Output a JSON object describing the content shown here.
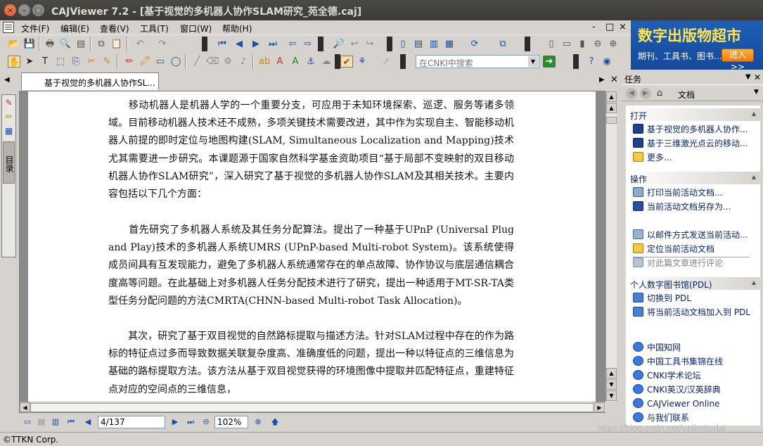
{
  "window": {
    "title": "CAJViewer 7.2 - [基于视觉的多机器人协作SLAM研究_苑全德.caj]",
    "close": "×",
    "minimize": "–",
    "maximize": "□"
  },
  "menu": {
    "items": [
      "文件(F)",
      "编辑(E)",
      "查看(V)",
      "工具(T)",
      "窗口(W)",
      "帮助(H)"
    ],
    "mdi_min": "-",
    "mdi_restore": "□",
    "mdi_close": "×"
  },
  "toolbar": {
    "cnki_search_placeholder": "在CNKI中搜索"
  },
  "ad": {
    "title": "数字出版物超市",
    "subtitle": "期刊、工具书、图书...",
    "button": "进入>>"
  },
  "tabs": {
    "doc_tab": "基于视觉的多机器人协作SL..."
  },
  "sidebar": {
    "catalog_label": "目录"
  },
  "document": {
    "paragraphs": [
      "　　移动机器人是机器人学的一个重要分支，可应用于未知环境探索、巡逻、服务等诸多领域。目前移动机器人技术还不成熟，多项关键技术需要改进，其中作为实现自主、智能移动机器人前提的即时定位与地图构建(SLAM, Simultaneous Localization and Mapping)技术尤其需要进一步研究。本课题源于国家自然科学基金资助项目“基于局部不变映射的双目移动机器人协作SLAM研究”，深入研究了基于视觉的多机器人协作SLAM及其相关技术。主要内容包括以下几个方面：",
      "　　首先研究了多机器人系统及其任务分配算法。提出了一种基于UPnP (Universal Plug and Play)技术的多机器人系统UMRS (UPnP-based Multi-robot System)。该系统使得成员间具有互发现能力，避免了多机器人系统通常存在的单点故障、协作协议与底层通信耦合度高等问题。在此基础上对多机器人任务分配技术进行了研究，提出一种适用于MT-SR-TA类型任务分配问题的方法CMRTA(CHNN-based Multi-robot Task Allocation)。",
      "　　其次，研究了基于双目视觉的自然路标提取与描述方法。针对SLAM过程中存在的作为路标的特征点过多而导致数据关联复杂度高、准确度低的问题，提出一种以特征点的三维信息为基础的路标提取方法。该方法从基于双目视觉获得的环境图像中提取并匹配特征点，重建特征点对应的空间点的三维信息，"
    ]
  },
  "navbar": {
    "page": "4/137",
    "zoom": "102%"
  },
  "taskpane": {
    "header": "任务",
    "doc_label": "文档",
    "sections": {
      "open": {
        "title": "打开",
        "links": [
          "基于视觉的多机器人协作...",
          "基于三维激光点云的移动...",
          "更多..."
        ]
      },
      "actions": {
        "title": "操作",
        "links": [
          "打印当前活动文档...",
          "当前活动文档另存为...",
          "以邮件方式发送当前活动...",
          "定位当前活动文档",
          "对此篇文章进行评论"
        ]
      },
      "pdl": {
        "title": "个人数字图书馆(PDL)",
        "links": [
          "切换到 PDL",
          "将当前活动文档加入到 PDL"
        ]
      },
      "web": {
        "links": [
          "中国知网",
          "中国工具书集锦在线",
          "CNKI学术论坛",
          "CNKI英汉/汉英辞典",
          "CAJViewer Online",
          "与我们联系"
        ]
      }
    }
  },
  "status": {
    "text": "©TTKN Corp."
  },
  "watermark": "https://blog.csdn.net/unlimitedai"
}
